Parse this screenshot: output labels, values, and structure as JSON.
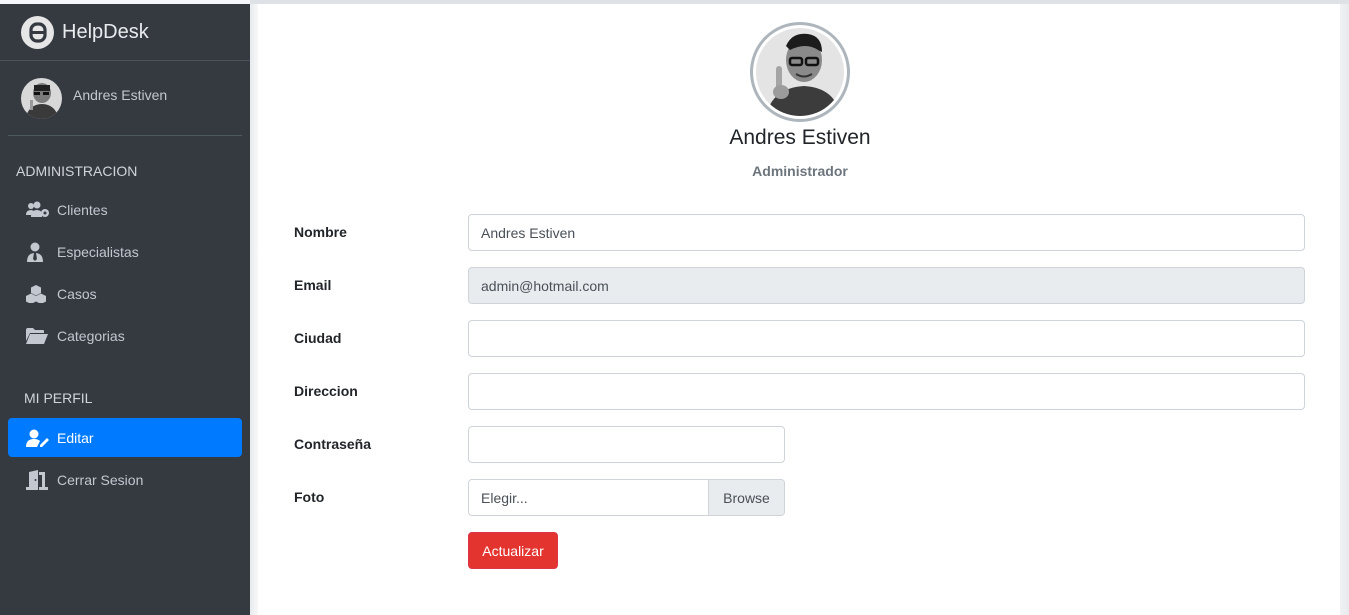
{
  "brand": {
    "name": "HelpDesk"
  },
  "user_panel": {
    "name": "Andres Estiven"
  },
  "sidebar": {
    "admin_header": "ADMINISTRACION",
    "admin_items": [
      {
        "label": "Clientes",
        "icon": "users-cog-icon"
      },
      {
        "label": "Especialistas",
        "icon": "user-tie-icon"
      },
      {
        "label": "Casos",
        "icon": "cubes-icon"
      },
      {
        "label": "Categorias",
        "icon": "folder-open-icon"
      }
    ],
    "profile_header": "MI PERFIL",
    "profile_items": [
      {
        "label": "Editar",
        "icon": "user-edit-icon",
        "active": true
      },
      {
        "label": "Cerrar Sesion",
        "icon": "door-open-icon"
      }
    ]
  },
  "profile": {
    "name": "Andres Estiven",
    "role": "Administrador"
  },
  "form": {
    "nombre_label": "Nombre",
    "nombre_value": "Andres Estiven",
    "email_label": "Email",
    "email_value": "admin@hotmail.com",
    "ciudad_label": "Ciudad",
    "ciudad_value": "",
    "direccion_label": "Direccion",
    "direccion_value": "",
    "password_label": "Contraseña",
    "password_value": "",
    "foto_label": "Foto",
    "foto_placeholder": "Elegir...",
    "foto_browse": "Browse",
    "submit_label": "Actualizar"
  },
  "colors": {
    "sidebar_bg": "#343a40",
    "active_item": "#007bff",
    "submit_button": "#e3342f"
  }
}
